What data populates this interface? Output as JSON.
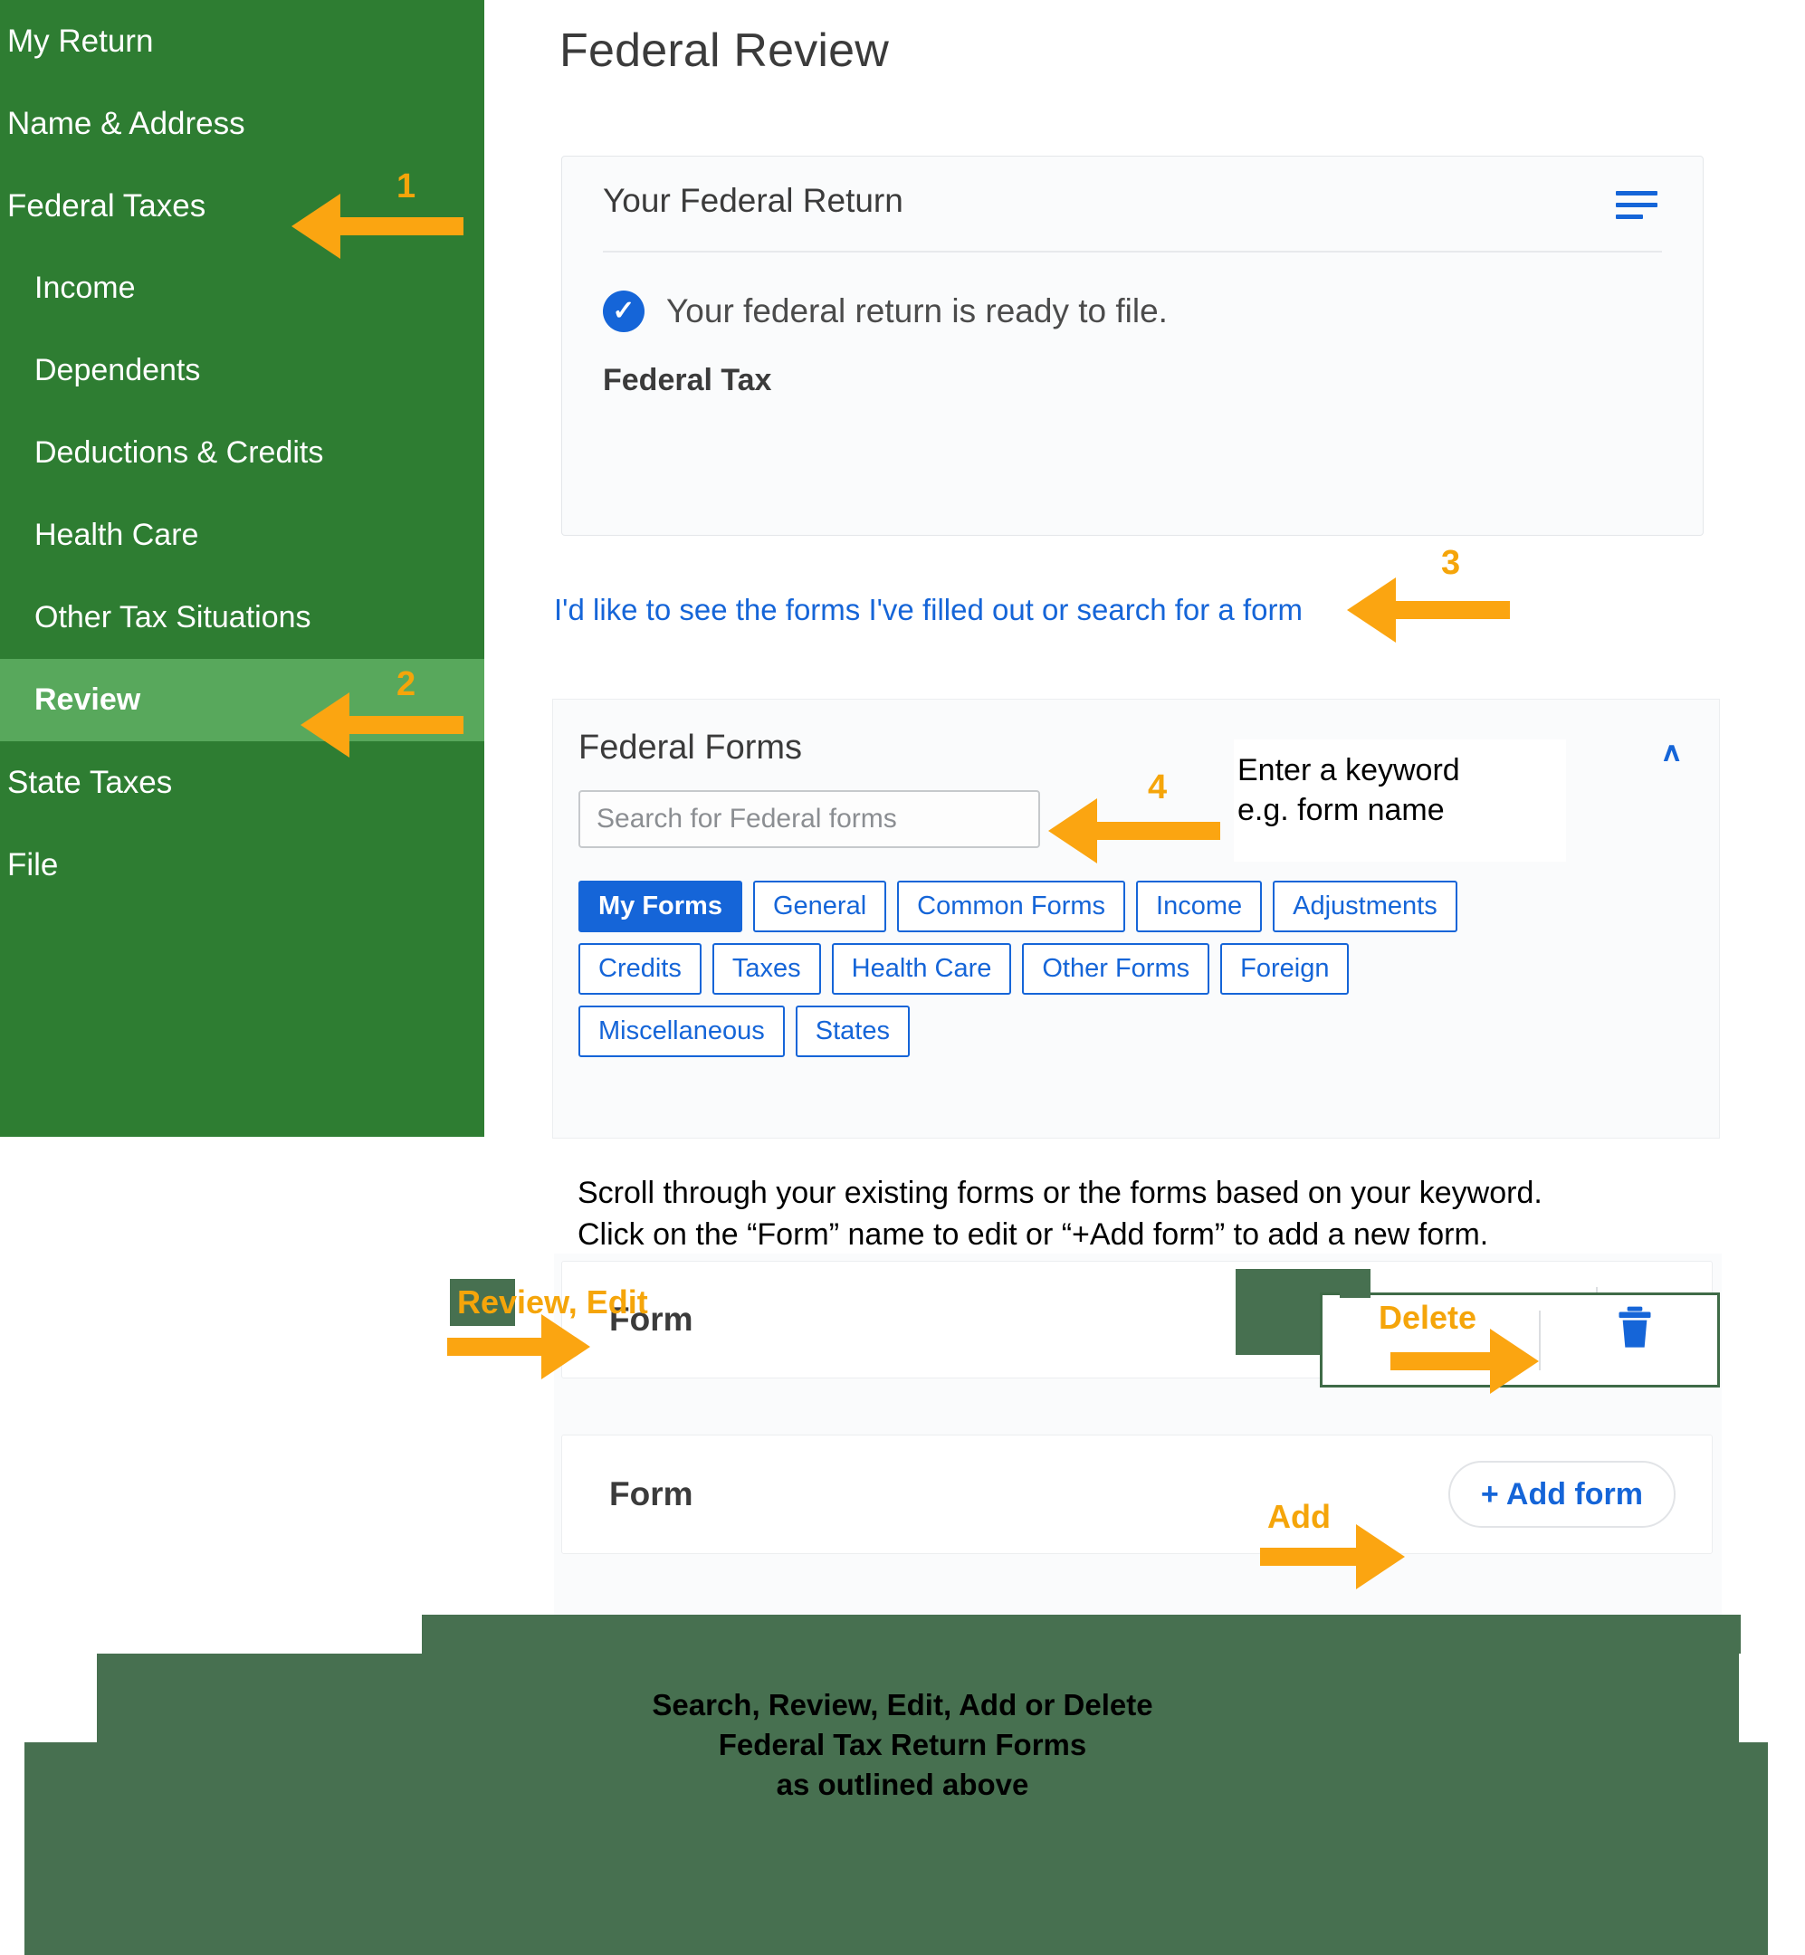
{
  "sidebar": {
    "items": [
      {
        "label": "My Return",
        "level": "top",
        "active": false
      },
      {
        "label": "Name & Address",
        "level": "top",
        "active": false
      },
      {
        "label": "Federal Taxes",
        "level": "top",
        "active": false
      },
      {
        "label": "Income",
        "level": "sub",
        "active": false
      },
      {
        "label": "Dependents",
        "level": "sub",
        "active": false
      },
      {
        "label": "Deductions & Credits",
        "level": "sub",
        "active": false
      },
      {
        "label": "Health Care",
        "level": "sub",
        "active": false
      },
      {
        "label": "Other Tax Situations",
        "level": "sub",
        "active": false
      },
      {
        "label": "Review",
        "level": "sub",
        "active": true
      },
      {
        "label": "State Taxes",
        "level": "top",
        "active": false
      },
      {
        "label": "File",
        "level": "top",
        "active": false
      }
    ]
  },
  "main": {
    "page_title": "Federal Review",
    "federal_return_card": {
      "title": "Your Federal Return",
      "menu_icon": "hamburger-menu-icon",
      "status_icon": "check-circle-icon",
      "status_check_glyph": "✓",
      "status_text": "Your federal return is ready to file.",
      "subtext": "Federal Tax"
    },
    "forms_link": "I'd like to see the forms I've filled out or search for a form",
    "federal_forms": {
      "title": "Federal Forms",
      "collapse_icon": "chevron-up-icon",
      "collapse_glyph": "∧",
      "search_placeholder": "Search for Federal forms",
      "search_value": "",
      "chip_rows": [
        [
          "My Forms",
          "General",
          "Common Forms",
          "Income",
          "Adjustments"
        ],
        [
          "Credits",
          "Taxes",
          "Health Care",
          "Other Forms",
          "Foreign"
        ],
        [
          "Miscellaneous",
          "States"
        ]
      ],
      "active_chip": "My Forms"
    },
    "scroll_note_line1": "Scroll through your existing forms or the forms based on your keyword.",
    "scroll_note_line2": "Click on the “Form” name to edit or “+Add form” to add a new form.",
    "form_rows": [
      {
        "label": "Form",
        "action": "delete",
        "action_icon": "trash-icon"
      },
      {
        "label": "Form",
        "action": "add",
        "action_label": "+ Add form",
        "action_icon": "plus-icon"
      }
    ]
  },
  "callouts": {
    "num1": "1",
    "num2": "2",
    "num3": "3",
    "num4": "4",
    "keyword_line1": "Enter a keyword",
    "keyword_line2": "e.g. form name",
    "review_edit": "Review, Edit",
    "delete": "Delete",
    "add": "Add",
    "arrow_color": "#fba511"
  },
  "banner": {
    "line1": "Search, Review, Edit, Add or Delete",
    "line2": "Federal Tax Return Forms",
    "line3": "as outlined above",
    "color": "#477050"
  },
  "colors": {
    "sidebar_green": "#2e7d32",
    "sidebar_active_green": "#58a85c",
    "link_blue": "#1565d8",
    "accent_orange": "#fba511",
    "banner_green": "#477050"
  }
}
